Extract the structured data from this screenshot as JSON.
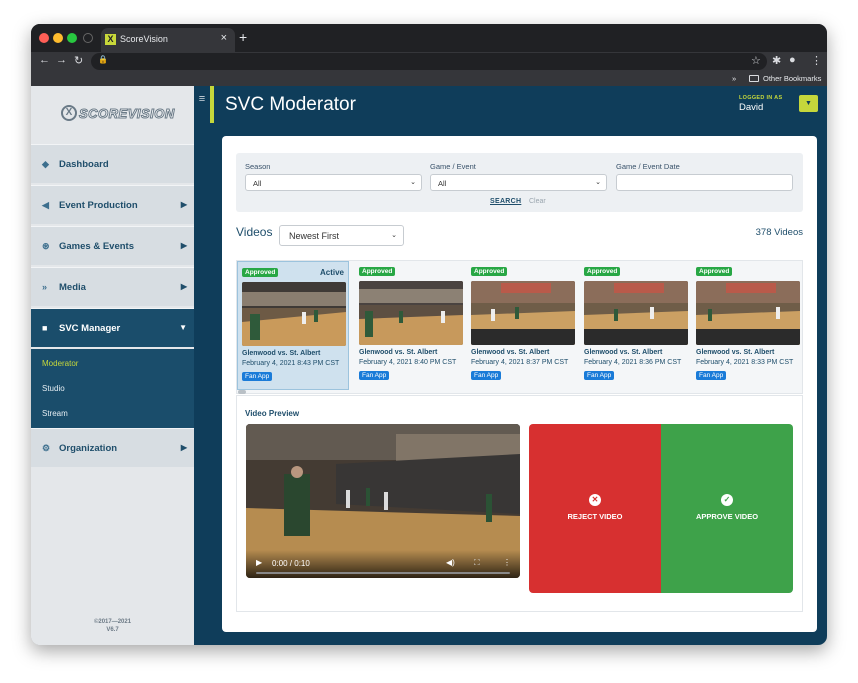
{
  "browser": {
    "tab_title": "ScoreVision",
    "tab_close": "×",
    "new_tab": "+",
    "favicon_letter": "X",
    "bookmarks_chevron": "»",
    "other_bookmarks": "Other Bookmarks"
  },
  "sidebar": {
    "logo_text": "SCOREVISION",
    "items": [
      {
        "label": "Dashboard",
        "icon": "dashboard-icon"
      },
      {
        "label": "Event Production",
        "icon": "megaphone-icon"
      },
      {
        "label": "Games & Events",
        "icon": "ball-icon"
      },
      {
        "label": "Media",
        "icon": "media-icon"
      },
      {
        "label": "SVC Manager",
        "icon": "video-camera-icon"
      },
      {
        "label": "Organization",
        "icon": "gears-icon"
      }
    ],
    "submenu": [
      "Moderator",
      "Studio",
      "Stream"
    ],
    "copyright": "©2017—2021",
    "version": "V6.7"
  },
  "header": {
    "title": "SVC Moderator",
    "logged_in_label": "LOGGED IN AS",
    "user": "David"
  },
  "filters": {
    "season_label": "Season",
    "season_value": "All",
    "event_label": "Game / Event",
    "event_value": "All",
    "date_label": "Game / Event Date",
    "date_value": "",
    "search": "SEARCH",
    "clear": "Clear"
  },
  "videos": {
    "heading": "Videos",
    "sort_value": "Newest First",
    "count": "378 Videos",
    "items": [
      {
        "status": "Approved",
        "active": "Active",
        "title": "Glenwood vs. St. Albert",
        "date": "February 4, 2021 8:43 PM CST",
        "source": "Fan App"
      },
      {
        "status": "Approved",
        "title": "Glenwood vs. St. Albert",
        "date": "February 4, 2021 8:40 PM CST",
        "source": "Fan App"
      },
      {
        "status": "Approved",
        "title": "Glenwood vs. St. Albert",
        "date": "February 4, 2021 8:37 PM CST",
        "source": "Fan App"
      },
      {
        "status": "Approved",
        "title": "Glenwood vs. St. Albert",
        "date": "February 4, 2021 8:36 PM CST",
        "source": "Fan App"
      },
      {
        "status": "Approved",
        "title": "Glenwood vs. St. Albert",
        "date": "February 4, 2021 8:33 PM CST",
        "source": "Fan App"
      }
    ]
  },
  "preview": {
    "label": "Video Preview",
    "time": "0:00 / 0:10",
    "reject": "REJECT VIDEO",
    "approve": "APPROVE VIDEO"
  },
  "colors": {
    "navy": "#0f3d5a",
    "accent": "#c5d73b",
    "reject": "#d73030",
    "approve": "#3ea24a",
    "badge_green": "#28a745",
    "badge_blue": "#1a7bd8"
  }
}
